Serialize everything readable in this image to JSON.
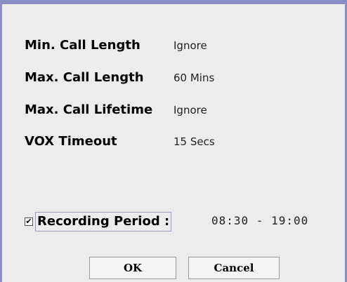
{
  "settings": [
    {
      "label": "Min. Call Length",
      "value": "Ignore"
    },
    {
      "label": "Max. Call Length",
      "value": "60 Mins"
    },
    {
      "label": "Max. Call Lifetime",
      "value": "Ignore"
    },
    {
      "label": "VOX Timeout",
      "value": "15 Secs"
    }
  ],
  "recording": {
    "checked": true,
    "check_glyph": "✔",
    "label": "Recording Period :",
    "value": "08:30 - 19:00"
  },
  "buttons": {
    "ok_label": "OK",
    "cancel_label": "Cancel"
  },
  "colors": {
    "frame": "#8c8cc6",
    "background": "#ececec"
  }
}
